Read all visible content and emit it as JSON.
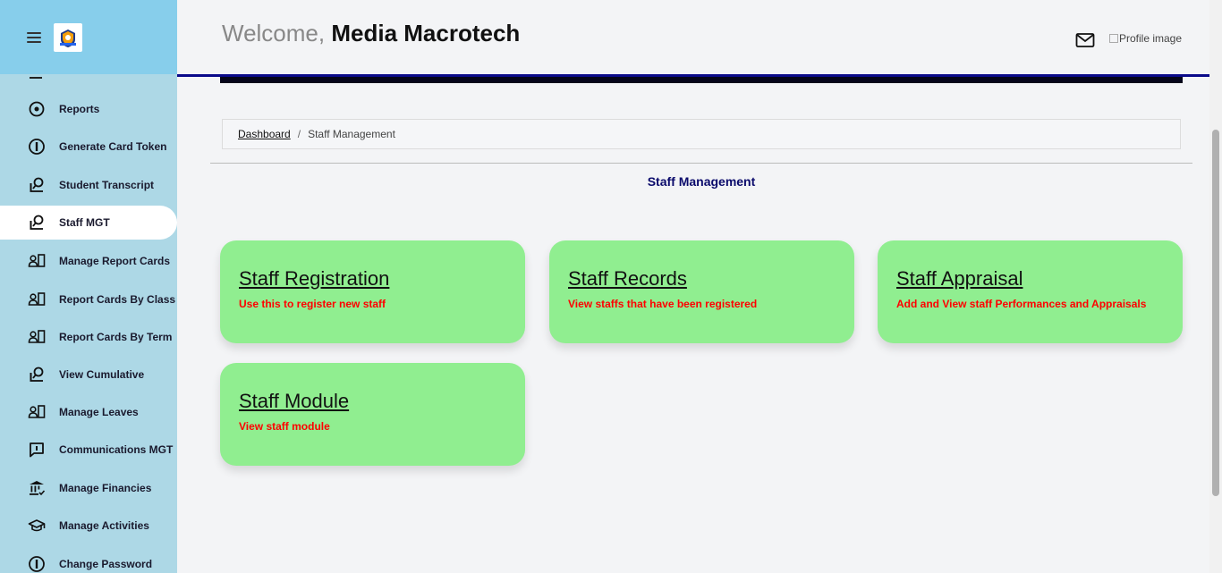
{
  "header": {
    "welcome_prefix": "Welcome,",
    "user_name": "Media Macrotech",
    "profile_image_alt": "Profile image"
  },
  "sidebar": {
    "items": [
      {
        "label": "Reports",
        "icon": "target-icon"
      },
      {
        "label": "Generate Card Token",
        "icon": "info-circle-icon"
      },
      {
        "label": "Student Transcript",
        "icon": "user-search-icon"
      },
      {
        "label": "Staff MGT",
        "icon": "user-search-icon",
        "active": true
      },
      {
        "label": "Manage Report Cards",
        "icon": "id-card-icon"
      },
      {
        "label": "Report Cards By Class",
        "icon": "id-card-icon"
      },
      {
        "label": "Report Cards By Term",
        "icon": "id-card-icon"
      },
      {
        "label": "View Cumulative",
        "icon": "user-search-icon"
      },
      {
        "label": "Manage Leaves",
        "icon": "id-card-icon"
      },
      {
        "label": "Communications MGT",
        "icon": "message-icon"
      },
      {
        "label": "Manage Financies",
        "icon": "bank-icon"
      },
      {
        "label": "Manage Activities",
        "icon": "graduation-cap-icon"
      },
      {
        "label": "Change Password",
        "icon": "info-circle-icon"
      }
    ]
  },
  "breadcrumb": {
    "home": "Dashboard",
    "separator": "/",
    "current": "Staff Management"
  },
  "page": {
    "title": "Staff Management"
  },
  "cards": [
    {
      "title": "Staff Registration",
      "description": "Use this to register new staff"
    },
    {
      "title": "Staff Records",
      "description": "View staffs that have been registered"
    },
    {
      "title": "Staff Appraisal",
      "description": "Add and View staff Performances and Appraisals"
    },
    {
      "title": "Staff Module",
      "description": "View staff module"
    }
  ],
  "colors": {
    "sidebar_bg": "#add8e6",
    "sidebar_top_bg": "#87ceeb",
    "card_bg": "#90ee90",
    "card_desc": "#ff0000",
    "header_line": "#0a0a8a",
    "page_title": "#0a0a6b"
  }
}
